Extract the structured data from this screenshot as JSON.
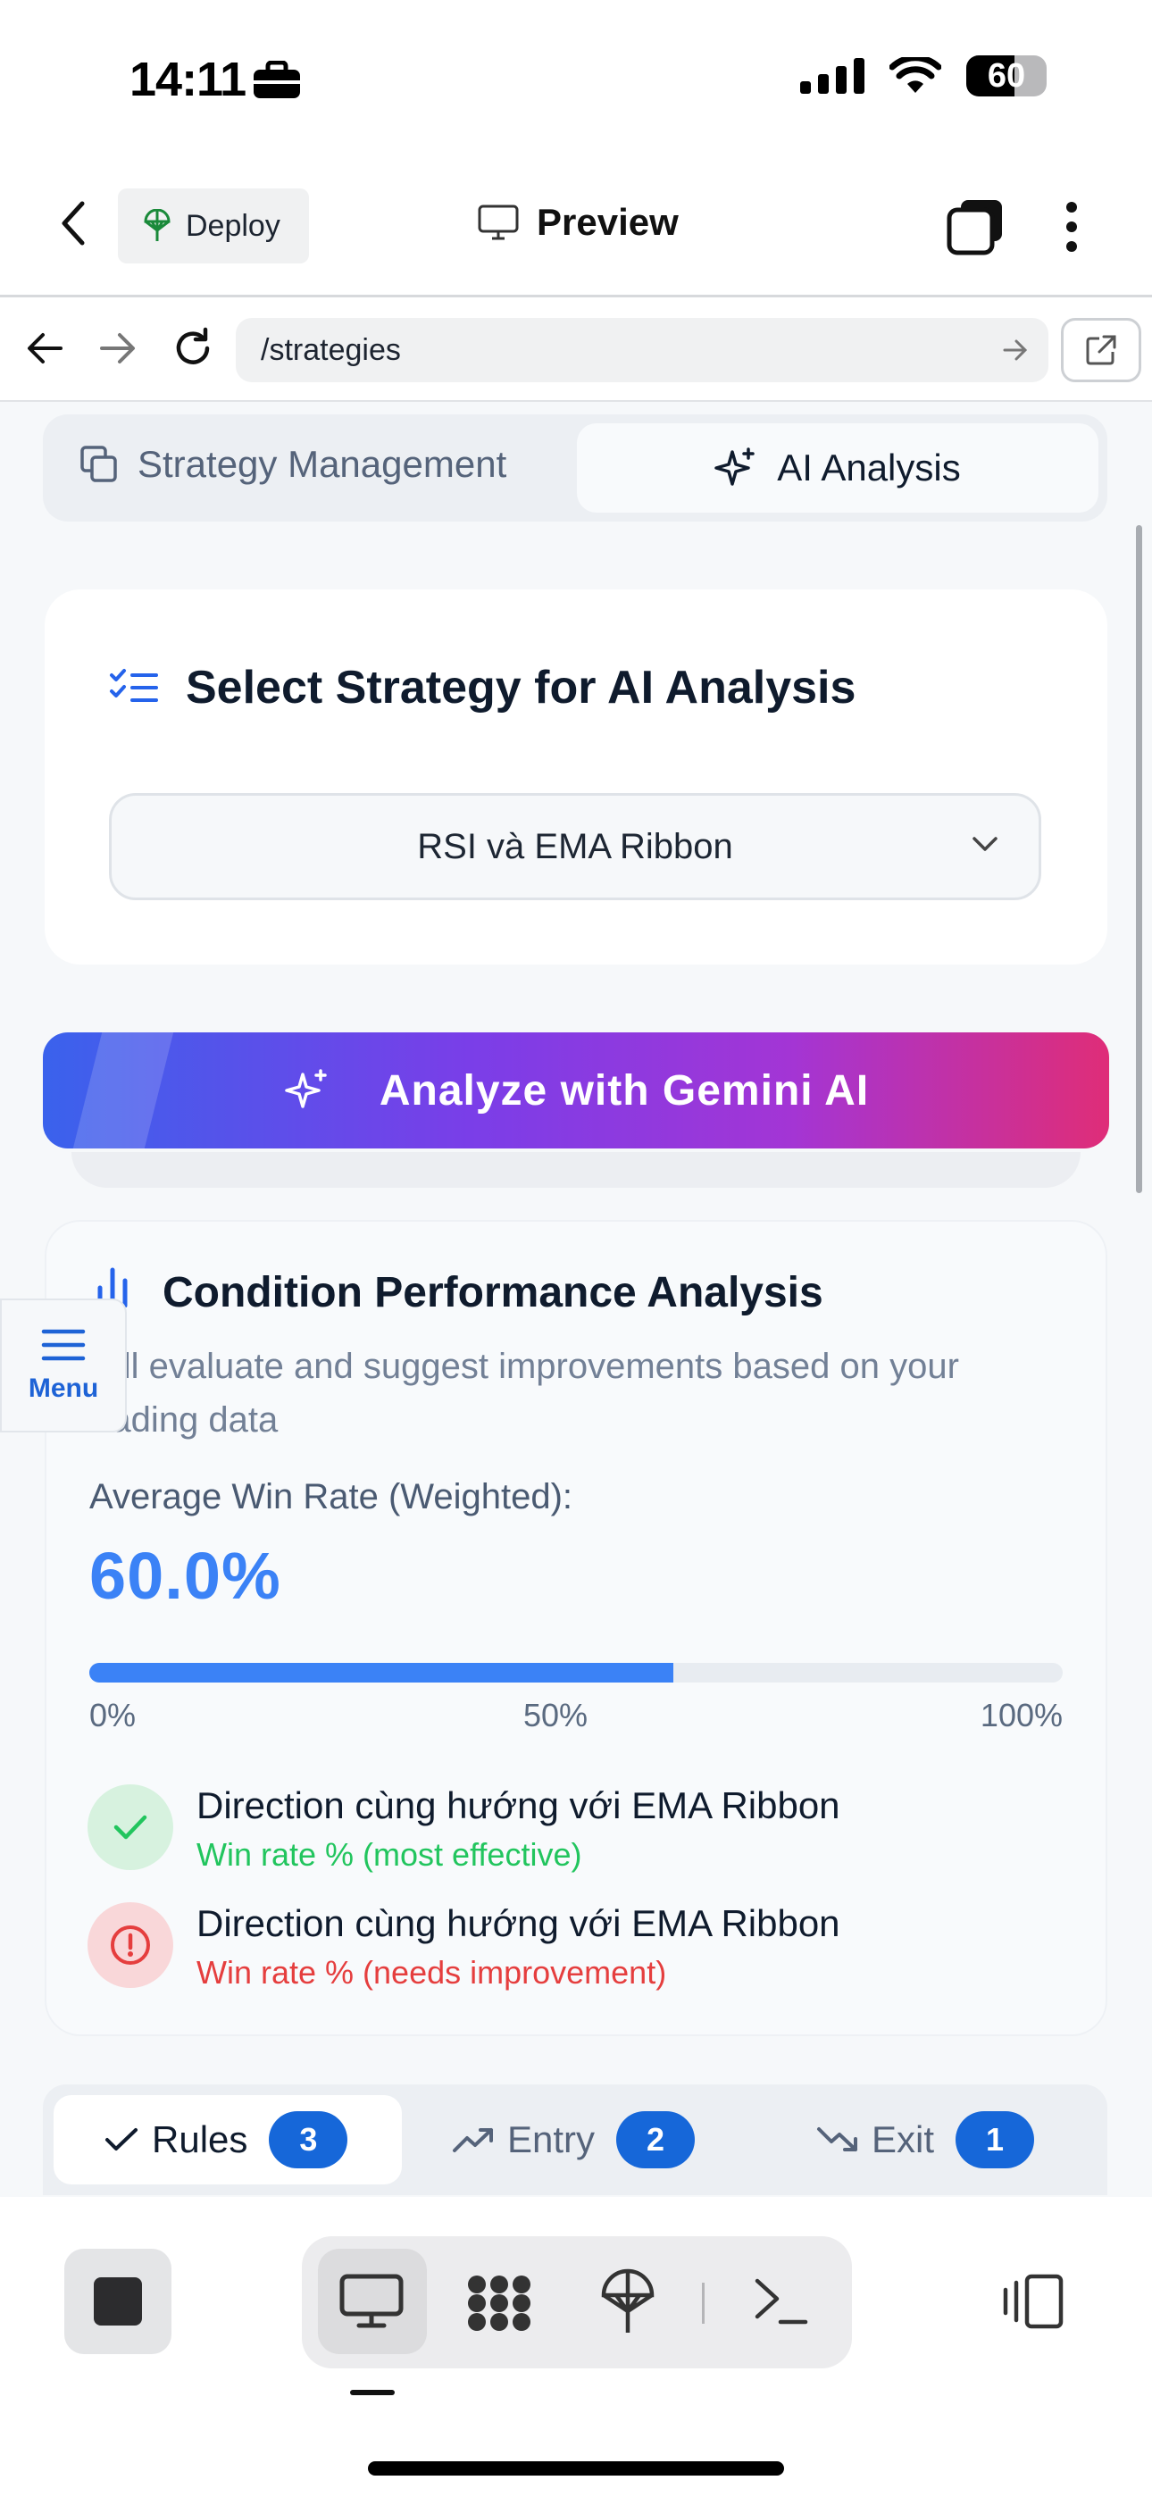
{
  "status_bar": {
    "time": "14:11",
    "battery": "60"
  },
  "header": {
    "deploy_label": "Deploy",
    "title": "Preview"
  },
  "browser": {
    "url": "/strategies"
  },
  "tabs": [
    {
      "label": "Strategy Management",
      "icon": "copy-icon"
    },
    {
      "label": "AI Analysis",
      "icon": "sparkles-icon"
    }
  ],
  "select_card": {
    "title": "Select Strategy for AI Analysis",
    "selected": "RSI và EMA Ribbon"
  },
  "analyze_button": {
    "label": "Analyze with Gemini AI"
  },
  "analysis": {
    "title": "Condition Performance Analysis",
    "description": "will evaluate and suggest improvements based on your trading data",
    "avg_label": "Average Win Rate (Weighted):",
    "avg_value": "60.0%",
    "progress_fraction": 0.6,
    "ticks": [
      "0%",
      "50%",
      "100%"
    ],
    "conditions": [
      {
        "title": "Direction cùng hướng với EMA Ribbon",
        "subtitle": "Win rate % (most effective)",
        "status": "success",
        "color": "#22c55e"
      },
      {
        "title": "Direction cùng hướng với EMA Ribbon",
        "subtitle": "Win rate % (needs improvement)",
        "status": "warning",
        "color": "#e53e3e"
      }
    ]
  },
  "menu": {
    "label": "Menu"
  },
  "bottom_tabs": [
    {
      "label": "Rules",
      "count": "3"
    },
    {
      "label": "Entry",
      "count": "2"
    },
    {
      "label": "Exit",
      "count": "1"
    }
  ],
  "colors": {
    "accent": "#3b82f6",
    "badge": "#1667d9",
    "gradient_start": "#3a62ec",
    "gradient_end": "#df2d78"
  }
}
